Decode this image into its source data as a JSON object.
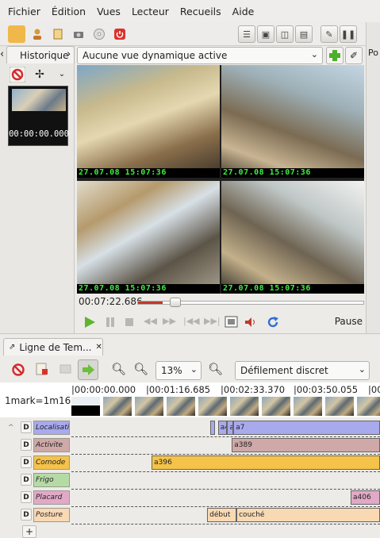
{
  "menu": [
    "Fichier",
    "Édition",
    "Vues",
    "Lecteur",
    "Recueils",
    "Aide"
  ],
  "left_panel": {
    "tab_label": "Historique",
    "thumb_time": "00:00:00.000"
  },
  "view": {
    "dynamic_view": "Aucune vue dynamique active",
    "right_tab": "Po"
  },
  "cameras": [
    {
      "timestamp": "27.07.08  15:07:36"
    },
    {
      "timestamp": "27.07.08  15:07:36"
    },
    {
      "timestamp": "27.07.08  15:07:36"
    },
    {
      "timestamp": "27.07.08  15:07:36"
    }
  ],
  "player": {
    "current_time": "00:07:22.686",
    "state": "Pause",
    "progress_fraction": 0.11
  },
  "timeline": {
    "tab_label": "Ligne de Tem...",
    "zoom": "13%",
    "scroll_mode": "Défilement discret",
    "scale_label": "1mark=1m16",
    "ticks": [
      "|00:00:00.000",
      "|00:01:16.685",
      "|00:02:33.370",
      "|00:03:50.055",
      "|00"
    ],
    "tracks": [
      {
        "name": "Localisatio",
        "color": "#a9a9ee",
        "segments": [
          {
            "label": "",
            "start": 0.45,
            "end": 0.465
          },
          {
            "label": "a4",
            "start": 0.475,
            "end": 0.505
          },
          {
            "label": "a1",
            "start": 0.505,
            "end": 0.525
          },
          {
            "label": "a7",
            "start": 0.525,
            "end": 1.0
          }
        ]
      },
      {
        "name": "Activite",
        "color": "#cfa8a8",
        "segments": [
          {
            "label": "a389",
            "start": 0.52,
            "end": 1.0
          }
        ]
      },
      {
        "name": "Comode",
        "color": "#f5c24a",
        "segments": [
          {
            "label": "a396",
            "start": 0.26,
            "end": 1.0
          }
        ]
      },
      {
        "name": "Frigo",
        "color": "#b5dba5",
        "segments": []
      },
      {
        "name": "Placard",
        "color": "#e2a9c7",
        "segments": [
          {
            "label": "a406",
            "start": 0.905,
            "end": 1.0
          }
        ]
      },
      {
        "name": "Posture",
        "color": "#f9d9b3",
        "segments": [
          {
            "label": "début",
            "start": 0.44,
            "end": 0.535
          },
          {
            "label": "couché",
            "start": 0.535,
            "end": 1.0
          }
        ]
      }
    ]
  }
}
